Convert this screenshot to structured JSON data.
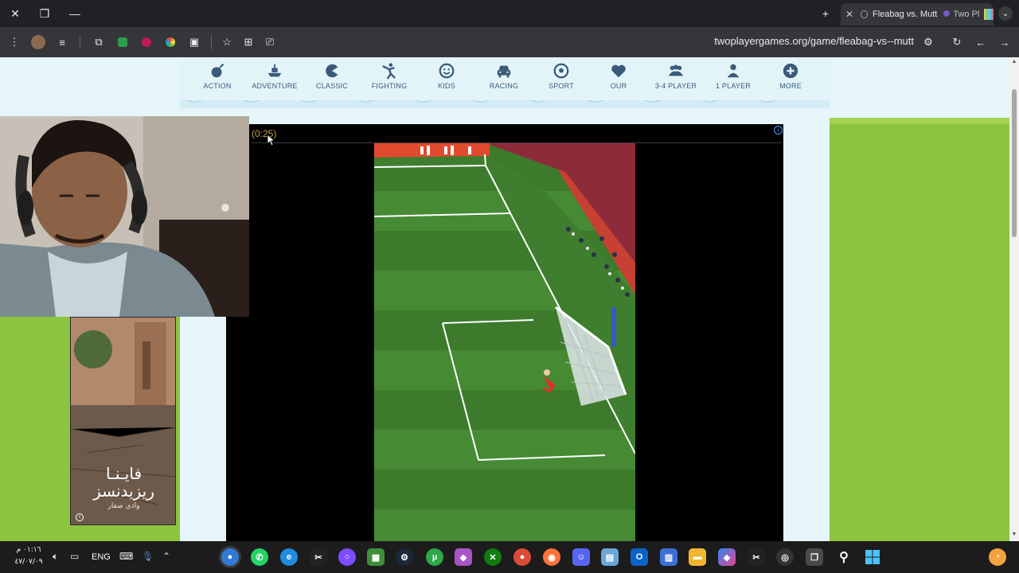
{
  "browser": {
    "tab_title": "Fleabag vs. Mutt",
    "tab2_title": "Two Pl",
    "url": "twoplayergames.org/game/fleabag-vs--mutt"
  },
  "nav": [
    {
      "label": "ACTION",
      "icon": "bomb-icon"
    },
    {
      "label": "ADVENTURE",
      "icon": "ship-icon"
    },
    {
      "label": "CLASSIC",
      "icon": "pacman-icon"
    },
    {
      "label": "FIGHTING",
      "icon": "fighter-icon"
    },
    {
      "label": "KIDS",
      "icon": "smiley-icon"
    },
    {
      "label": "RACING",
      "icon": "car-icon"
    },
    {
      "label": "SPORT",
      "icon": "ball-icon"
    },
    {
      "label": "OUR",
      "icon": "heart-icon"
    },
    {
      "label": "3-4 PLAYER",
      "icon": "group-icon"
    },
    {
      "label": "1 PLAYER",
      "icon": "person-icon"
    },
    {
      "label": "MORE",
      "icon": "plus-circle-icon"
    }
  ],
  "video": {
    "timer": "(0:25)"
  },
  "ad": {
    "line1": "فايـنـا",
    "line2": "ريزيدنسز",
    "line3": "وادي صفار"
  },
  "taskbar": {
    "time": "٠١:١٦ م",
    "date": "٤٧/٠٧/٠٩",
    "lang": "ENG"
  },
  "colors": {
    "grass": "#8cc33f",
    "page_bg": "#e5f5fa",
    "nav_icon": "#3a5a7a"
  }
}
